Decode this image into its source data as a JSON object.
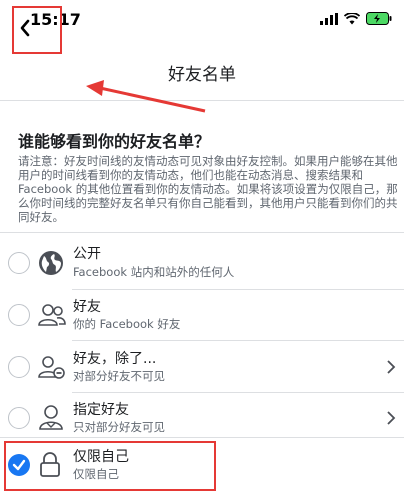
{
  "status": {
    "time": "15:17"
  },
  "nav": {
    "title": "好友名单"
  },
  "question": "谁能够看到你的好友名单？",
  "note": "请注意：好友时间线的友情动态可见对象由好友控制。如果用户能够在其他用户的时间线看到你的友情动态，他们也能在动态消息、搜索结果和 Facebook 的其他位置看到你的友情动态。如果将该项设置为仅限自己，那么你时间线的完整好友名单只有你自己能看到，其他用户只能看到你们的共同好友。",
  "options": [
    {
      "title": "公开",
      "subtitle": "Facebook 站内和站外的任何人",
      "icon": "globe-icon",
      "selected": false,
      "has_chevron": false
    },
    {
      "title": "好友",
      "subtitle": "你的 Facebook 好友",
      "icon": "friends-icon",
      "selected": false,
      "has_chevron": false
    },
    {
      "title": "好友，除了...",
      "subtitle": "对部分好友不可见",
      "icon": "friends-except-icon",
      "selected": false,
      "has_chevron": true
    },
    {
      "title": "指定好友",
      "subtitle": "只对部分好友可见",
      "icon": "specific-friends-icon",
      "selected": false,
      "has_chevron": true
    },
    {
      "title": "仅限自己",
      "subtitle": "仅限自己",
      "icon": "lock-icon",
      "selected": true,
      "has_chevron": false
    }
  ],
  "colors": {
    "accent": "#1877f2",
    "annotation": "#e53935",
    "secondary_text": "#606770"
  }
}
